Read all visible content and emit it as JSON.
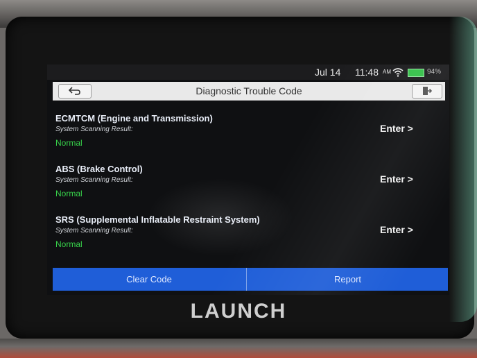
{
  "status_bar": {
    "date": "Jul 14",
    "time": "11:48",
    "ampm": "AM",
    "battery": "94%"
  },
  "header": {
    "title": "Diagnostic Trouble Code"
  },
  "systems": [
    {
      "name": "ECMTCM (Engine and Transmission)",
      "scan_label": "System Scanning Result:",
      "result": "Normal",
      "action": "Enter >"
    },
    {
      "name": "ABS (Brake Control)",
      "scan_label": "System Scanning Result:",
      "result": "Normal",
      "action": "Enter >"
    },
    {
      "name": "SRS (Supplemental Inflatable Restraint System)",
      "scan_label": "System Scanning Result:",
      "result": "Normal",
      "action": "Enter >"
    }
  ],
  "footer": {
    "clear_label": "Clear Code",
    "report_label": "Report"
  },
  "device": {
    "brand": "LAUNCH"
  },
  "colors": {
    "accent": "#1f5ed8",
    "normal": "#37d24a",
    "battery": "#35c04a"
  }
}
